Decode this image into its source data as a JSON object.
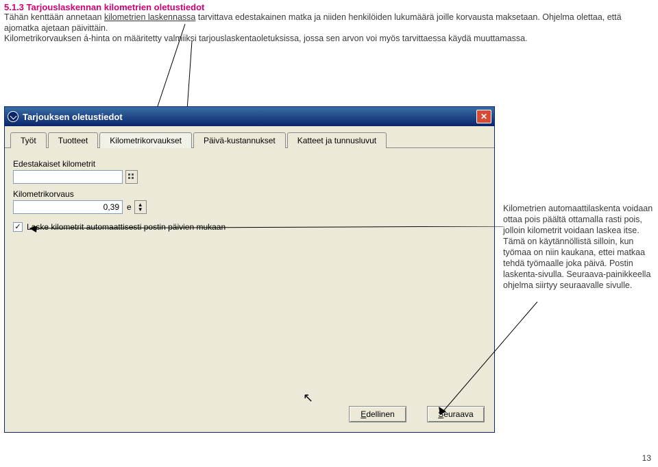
{
  "heading": "5.1.3 Tarjouslaskennan kilometrien oletustiedot",
  "intro_html_parts": {
    "p1_a": "Tähän kenttään annetaan ",
    "p1_b_underlined": "kilometrien laskennassa",
    "p1_c": " tarvittava edestakainen matka ja niiden henkilöiden lukumäärä joille korvausta maksetaan. Ohjelma olettaa, että ajomatka ajetaan päivittäin.",
    "p2": "Kilometrikorvauksen á-hinta on määritetty valmiiksi tarjouslaskentaoletuksissa, jossa sen arvon voi myös tarvittaessa käydä muuttamassa."
  },
  "window": {
    "title": "Tarjouksen oletustiedot",
    "close_glyph": "✕",
    "tabs": [
      "Työt",
      "Tuotteet",
      "Kilometrikorvaukset",
      "Päivä-kustannukset",
      "Katteet ja tunnusluvut"
    ],
    "active_tab_index": 2,
    "fields": {
      "km_label": "Edestakaiset kilometrit",
      "km_value": "",
      "korvaus_label": "Kilometrikorvaus",
      "korvaus_value": "0,39",
      "korvaus_unit": "e"
    },
    "checkbox": {
      "checked_glyph": "✓",
      "label": "Laske kilometrit automaattisesti postin päivien mukaan"
    },
    "buttons": {
      "prev_mnemonic": "E",
      "prev_rest": "dellinen",
      "next_mnemonic": "S",
      "next_rest": "euraava"
    }
  },
  "side_note": "Kilometrien automaattilaskenta voidaan ottaa pois päältä ottamalla rasti pois, jolloin kilometrit voidaan laskea itse. Tämä on käytännöllistä silloin, kun työmaa on niin kaukana, ettei matkaa tehdä työmaalle joka päivä. Postin laskenta-sivulla. Seuraava-painikkeella ohjelma siirtyy seuraavalle sivulle.",
  "page_number": "13"
}
